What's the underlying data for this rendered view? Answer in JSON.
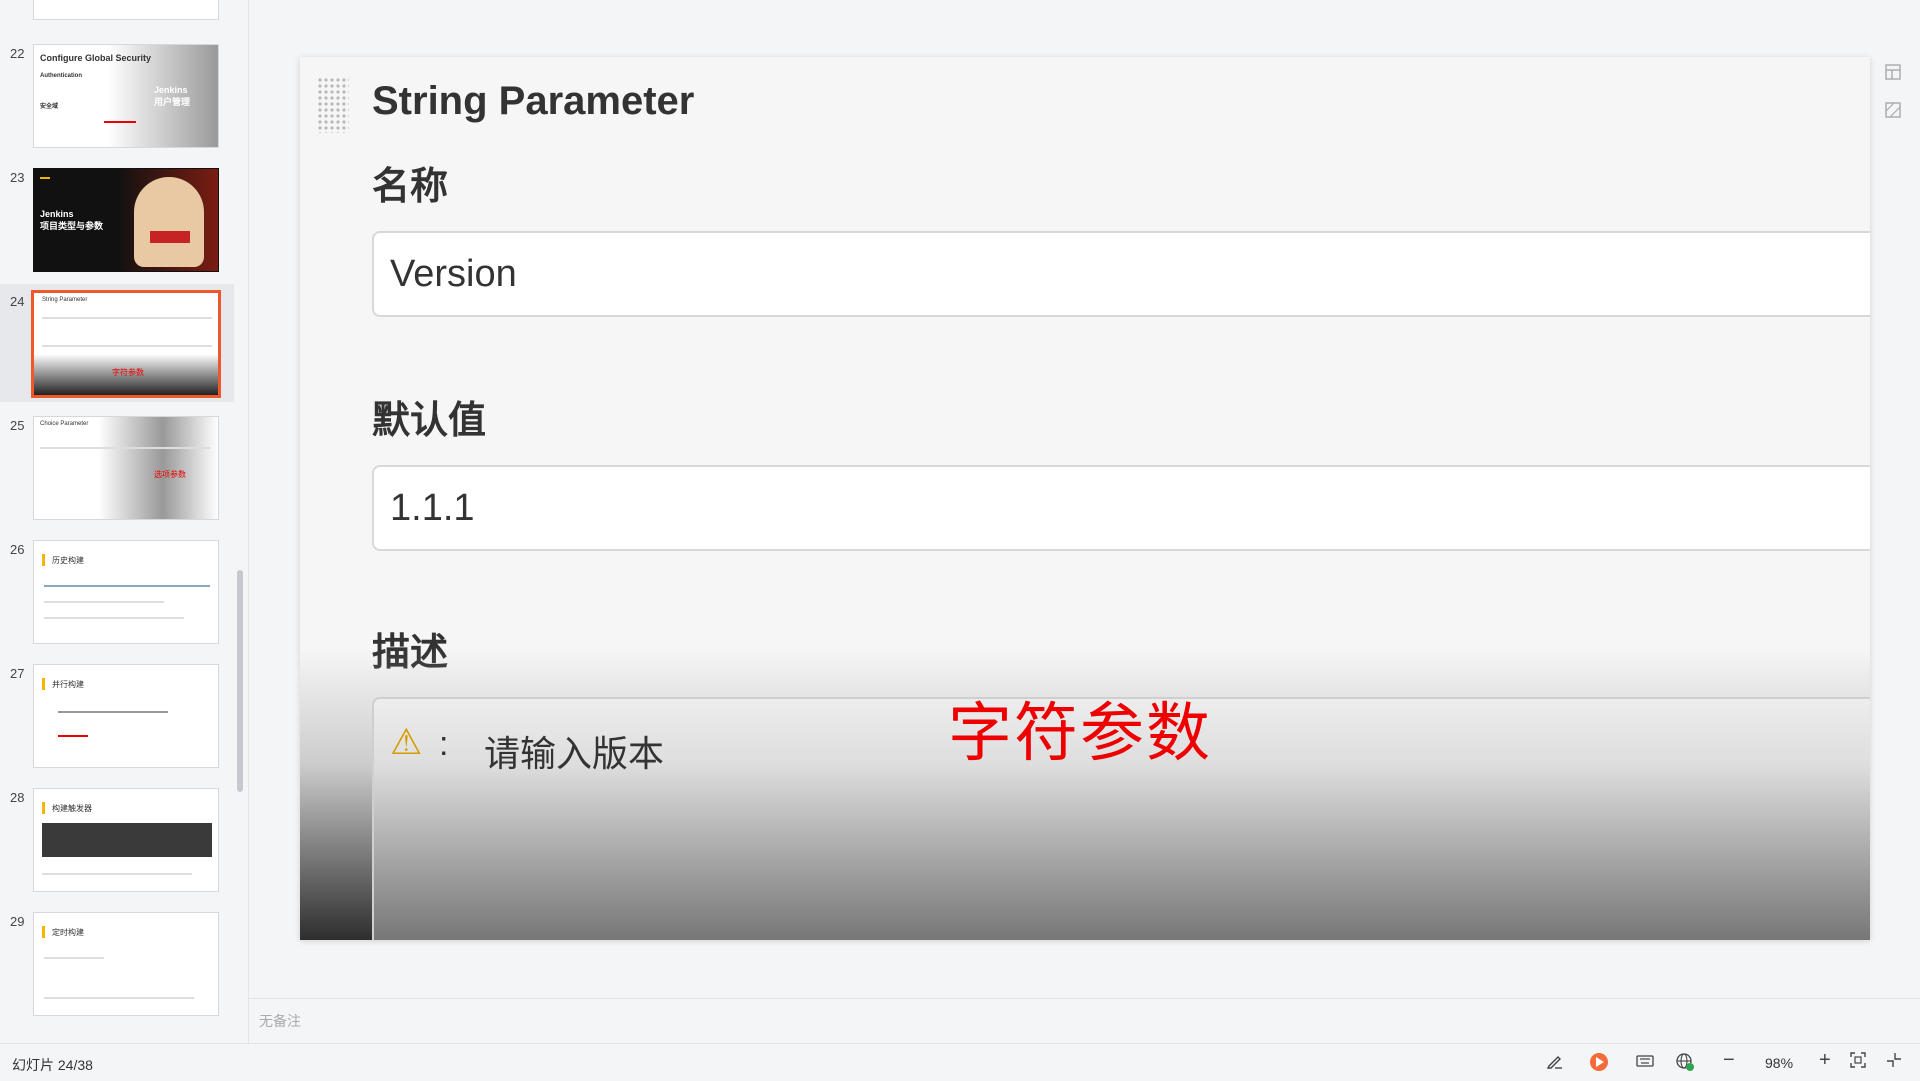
{
  "thumbnails": [
    {
      "num": "22",
      "title": "Configure Global Security",
      "overlay": "Jenkins\n用户管理",
      "sub": "Authentication",
      "sub2": "安全域"
    },
    {
      "num": "23",
      "title": "Jenkins\n项目类型与参数"
    },
    {
      "num": "24",
      "title": "String Parameter",
      "caption": "字符参数",
      "active": true
    },
    {
      "num": "25",
      "title": "Choice Parameter",
      "caption": "选项参数"
    },
    {
      "num": "26",
      "title": "历史构建"
    },
    {
      "num": "27",
      "title": "并行构建"
    },
    {
      "num": "28",
      "title": "构建触发器"
    },
    {
      "num": "29",
      "title": "定时构建"
    }
  ],
  "slide": {
    "title": "String Parameter",
    "name_label": "名称",
    "name_value": "Version",
    "default_label": "默认值",
    "default_value": "1.1.1",
    "desc_label": "描述",
    "warn_icon": "⚠",
    "desc_colon": ":",
    "desc_hint": "请输入版本",
    "caption": "字符参数"
  },
  "notes": {
    "placeholder": "无备注"
  },
  "status": {
    "slide_counter": "幻灯片 24/38",
    "zoom": "98%",
    "zoom_out": "−",
    "zoom_in": "+"
  },
  "colors": {
    "accent": "#f0582b",
    "caption_red": "#ee0000"
  }
}
